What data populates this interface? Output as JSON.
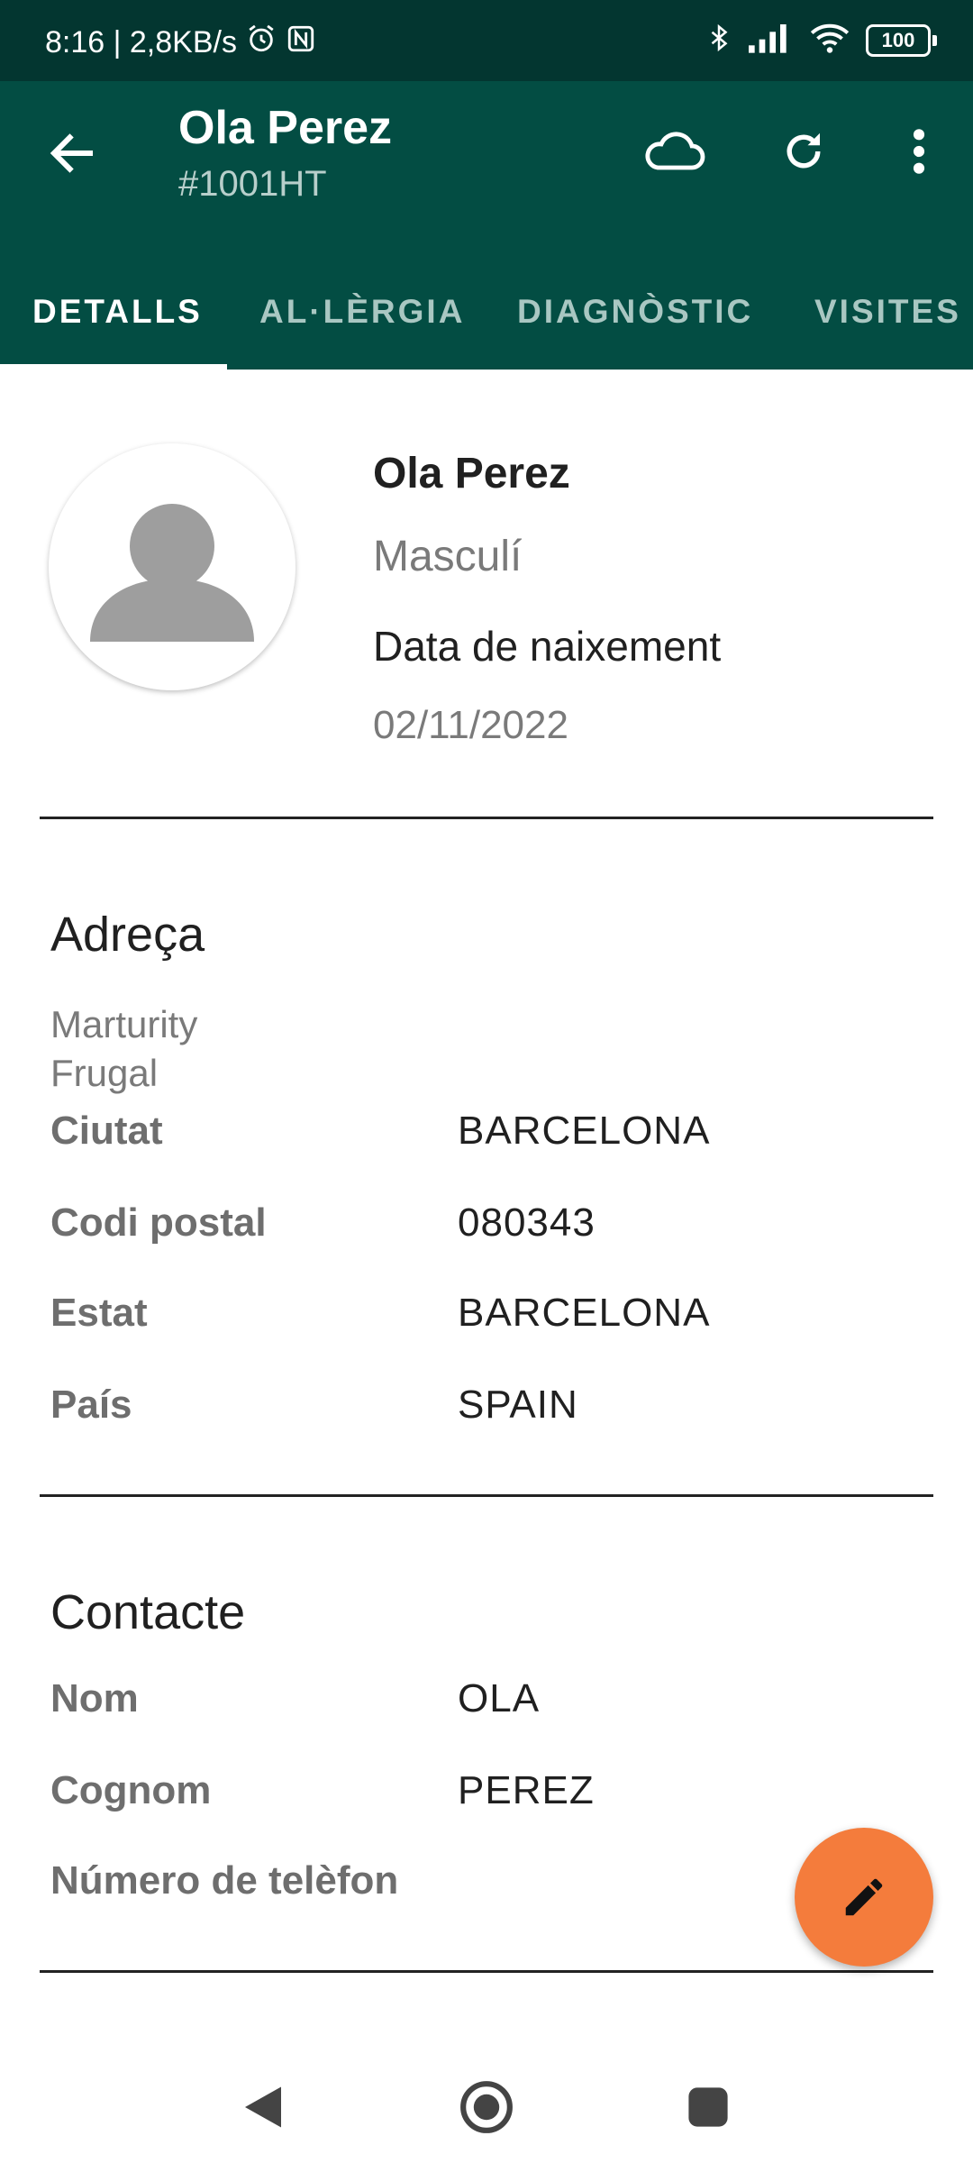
{
  "status_bar": {
    "time_speed": "8:16 | 2,8KB/s",
    "battery": "100",
    "icons": [
      "alarm-icon",
      "nfc-icon",
      "bluetooth-icon",
      "signal-icon",
      "wifi-icon",
      "battery-icon"
    ]
  },
  "app_bar": {
    "title": "Ola Perez",
    "subtitle": "#1001HT",
    "actions": [
      "cloud-icon",
      "refresh-icon",
      "more-vert-icon"
    ]
  },
  "tabs": [
    {
      "label": "DETALLS",
      "active": true
    },
    {
      "label": "AL·LÈRGIA",
      "active": false
    },
    {
      "label": "DIAGNÒSTIC",
      "active": false
    },
    {
      "label": "VISITES",
      "active": false
    }
  ],
  "profile": {
    "name": "Ola Perez",
    "gender": "Masculí",
    "dob_label": "Data de naixement",
    "dob": "02/11/2022"
  },
  "address": {
    "title": "Adreça",
    "line1": "Marturity",
    "line2": "Frugal",
    "rows": [
      {
        "label": "Ciutat",
        "value": "BARCELONA"
      },
      {
        "label": "Codi postal",
        "value": "080343"
      },
      {
        "label": "Estat",
        "value": "BARCELONA"
      },
      {
        "label": "País",
        "value": "SPAIN"
      }
    ]
  },
  "contact": {
    "title": "Contacte",
    "rows": [
      {
        "label": "Nom",
        "value": "OLA"
      },
      {
        "label": "Cognom",
        "value": "PEREZ"
      },
      {
        "label": "Número de telèfon",
        "value": ""
      }
    ]
  },
  "colors": {
    "status_bar": "#033630",
    "app_bar": "#034d43",
    "fab": "#f47c3c"
  }
}
